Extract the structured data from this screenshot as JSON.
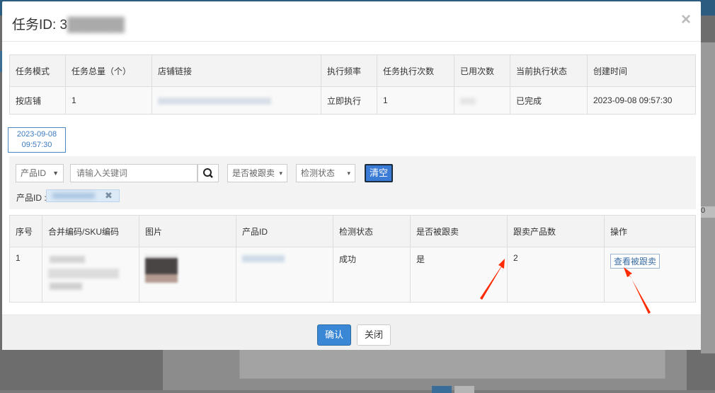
{
  "modal": {
    "title_prefix": "任务ID: 3",
    "title_masked": "██████",
    "close_glyph": "×"
  },
  "task_table": {
    "headers": [
      "任务模式",
      "任务总量（个）",
      "店铺链接",
      "执行频率",
      "任务执行次数",
      "已用次数",
      "当前执行状态",
      "创建时间"
    ],
    "row": {
      "mode": "按店铺",
      "total": "1",
      "frequency": "立即执行",
      "exec_count": "1",
      "status": "已完成",
      "created": "2023-09-08 09:57:30"
    }
  },
  "date_tab": {
    "line1": "2023-09-08",
    "line2": "09:57:30"
  },
  "filters": {
    "field_select": "产品ID",
    "keyword_placeholder": "请输入关键词",
    "tracked_select": "是否被跟卖",
    "check_select": "检测状态",
    "clear_label": "清空",
    "product_id_label": "产品ID :"
  },
  "product_table": {
    "headers": [
      "序号",
      "合并编码/SKU编码",
      "图片",
      "产品ID",
      "检测状态",
      "是否被跟卖",
      "跟卖产品数",
      "操作"
    ],
    "rows": [
      {
        "index": "1",
        "check_status": "成功",
        "tracked": "是",
        "follow_count": "2",
        "action": "查看被跟卖"
      }
    ]
  },
  "footer": {
    "confirm": "确认",
    "close": "关闭"
  },
  "colors": {
    "primary": "#3a87d6",
    "arrow": "#ff2a00",
    "header_bg": "#f3f3f3"
  }
}
